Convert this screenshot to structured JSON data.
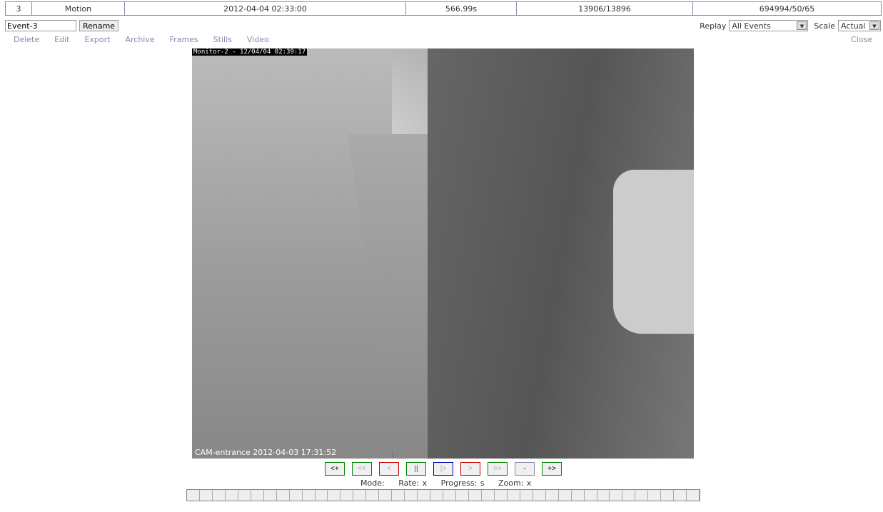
{
  "event": {
    "id": "3",
    "cause": "Motion",
    "start": "2012-04-04 02:33:00",
    "duration": "566.99s",
    "frames": "13906/13896",
    "score": "694994/50/65"
  },
  "name_field": {
    "value": "Event-3"
  },
  "rename_label": "Rename",
  "links": [
    "Delete",
    "Edit",
    "Export",
    "Archive",
    "Frames",
    "Stills",
    "Video"
  ],
  "replay": {
    "label": "Replay",
    "value": "All Events"
  },
  "scale": {
    "label": "Scale",
    "value": "Actual"
  },
  "close_label": "Close",
  "image": {
    "overlay_top": "Monitor-2 - 12/04/04 02:39:17",
    "overlay_bottom": "CAM-entrance 2012-04-03 17:31:52"
  },
  "controls": [
    {
      "label": "<+",
      "name": "prev-event-button",
      "color": "#008800",
      "text": "#000"
    },
    {
      "label": "<<",
      "name": "fast-rewind-button",
      "color": "#008800",
      "text": "#aaa"
    },
    {
      "label": "<",
      "name": "step-back-button",
      "color": "#cc0000",
      "text": "#aaa"
    },
    {
      "label": "||",
      "name": "pause-button",
      "color": "#008800",
      "text": "#444"
    },
    {
      "label": "|>",
      "name": "play-button",
      "color": "#0000aa",
      "text": "#aaa"
    },
    {
      "label": ">",
      "name": "step-forward-button",
      "color": "#cc0000",
      "text": "#aaa"
    },
    {
      "label": ">>",
      "name": "fast-forward-button",
      "color": "#008800",
      "text": "#aaa"
    },
    {
      "label": "-",
      "name": "zoom-out-button",
      "color": "#8888aa",
      "text": "#000"
    },
    {
      "label": "+>",
      "name": "next-event-button",
      "color": "#008800",
      "text": "#000"
    }
  ],
  "status": {
    "mode": "Mode:",
    "rate": "Rate: x",
    "progress": "Progress: s",
    "zoom": "Zoom: x"
  },
  "progress_fraction": 0
}
